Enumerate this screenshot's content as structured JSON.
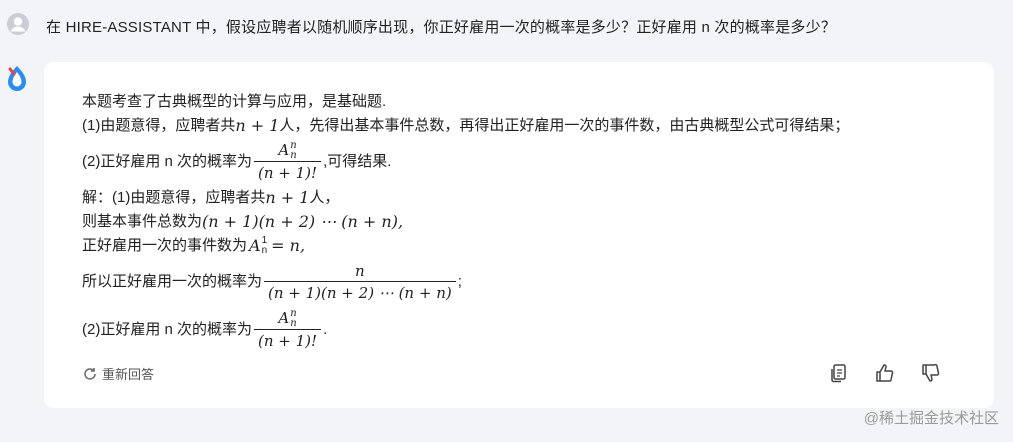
{
  "question": {
    "text": "在 HIRE-ASSISTANT 中，假设应聘者以随机顺序出现，你正好雇用一次的概率是多少？正好雇用 n 次的概率是多少？"
  },
  "answer": {
    "intro": "本题考查了古典概型的计算与应用，是基础题.",
    "line1_a": "(1)由题意得，应聘者共",
    "line1_math": "n + 1",
    "line1_b": "人，先得出基本事件总数，再得出正好雇用一次的事件数，由古典概型公式可得结果；",
    "line2_a": "(2)正好雇用 n 次的概率为",
    "line2_b": ",可得结果.",
    "sol_a": "解：(1)由题意得，应聘者共",
    "sol_math": "n + 1",
    "sol_b": "人，",
    "basic_a": "则基本事件总数为",
    "basic_math": "(n + 1)(n + 2) ⋯ (n + n),",
    "once_a": "正好雇用一次的事件数为",
    "once_math": "= n,",
    "prob_a": "所以正好雇用一次的概率为",
    "prob_num": "n",
    "prob_den": "(n + 1)(n + 2) ⋯ (n + n)",
    "prob_end": ";",
    "n_a": "(2)正好雇用 n 次的概率为",
    "n_end": ".",
    "frac_num": "A",
    "frac_den": "(n + 1)!",
    "sup_n": "n",
    "sub_n": "n",
    "sup_1": "1"
  },
  "regenerate_label": "重新回答",
  "footer_watermark": "@稀土掘金技术社区",
  "icons": [
    "user-avatar-icon",
    "bot-logo-icon",
    "refresh-icon",
    "copy-icon",
    "thumbs-up-icon",
    "thumbs-down-icon"
  ]
}
